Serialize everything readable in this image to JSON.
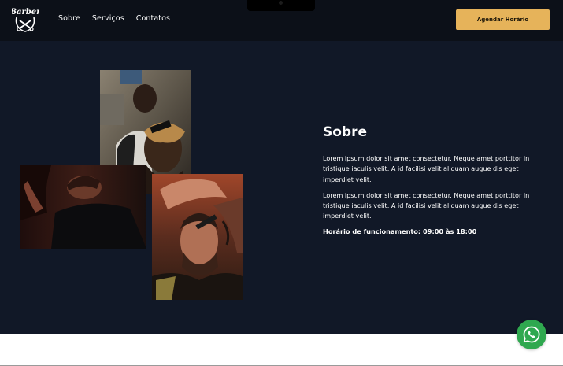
{
  "brand": {
    "logo_text": "Barber"
  },
  "nav": {
    "items": [
      {
        "label": "Sobre"
      },
      {
        "label": "Serviços"
      },
      {
        "label": "Contatos"
      }
    ]
  },
  "cta": {
    "label": "Agendar Horário"
  },
  "about": {
    "title": "Sobre",
    "paragraphs": [
      "Lorem ipsum dolor sit amet consectetur. Neque amet porttitor in tristique iaculis velit. A id facilisi velit aliquam augue dis eget imperdiet velit.",
      "Lorem ipsum dolor sit amet consectetur. Neque amet porttitor in tristique iaculis velit. A id facilisi velit aliquam augue dis eget imperdiet velit."
    ],
    "hours": "Horário de funcionamento: 09:00 às 18:00"
  },
  "gallery": [
    {
      "subject": "barber-trimming-beard"
    },
    {
      "subject": "client-getting-shave"
    },
    {
      "subject": "barber-cutting-hair"
    }
  ],
  "floating": {
    "icon": "whatsapp-icon"
  },
  "colors": {
    "navbar_bg": "#0c1018",
    "hero_bg": "#111827",
    "accent": "#e6b35a",
    "whatsapp_green": "#2fa84f"
  }
}
